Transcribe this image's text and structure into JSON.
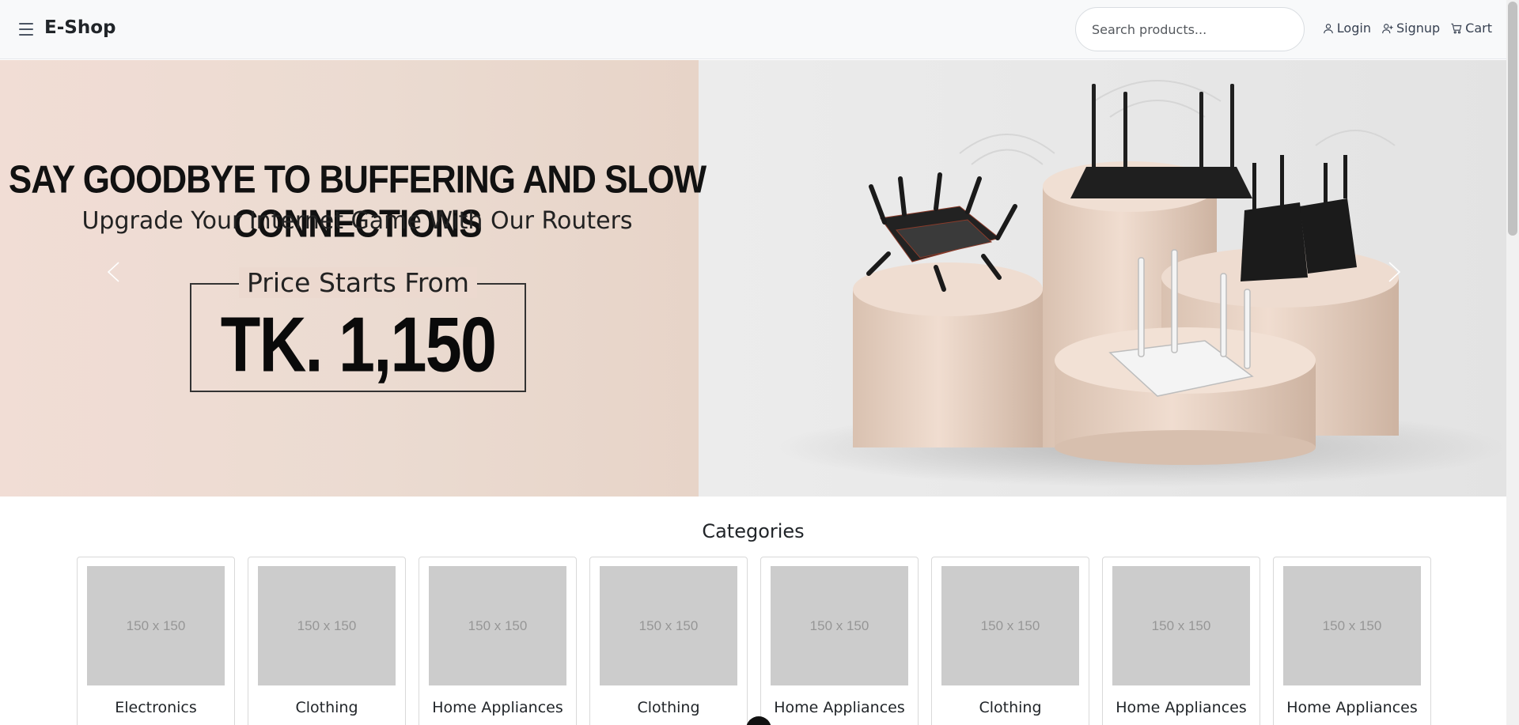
{
  "header": {
    "brand": "E-Shop",
    "search_placeholder": "Search products...",
    "links": {
      "login": "Login",
      "signup": "Signup",
      "cart": "Cart"
    }
  },
  "hero": {
    "headline": "SAY GOODBYE TO BUFFERING AND SLOW CONNECTIONS",
    "subline": "Upgrade Your Internet Game With Our Routers",
    "price_label": "Price Starts From",
    "price_value": "TK. 1,150"
  },
  "categories": {
    "title": "Categories",
    "placeholder_text": "150 x 150",
    "items": [
      {
        "name": "Electronics",
        "image_text": "150 x 150"
      },
      {
        "name": "Clothing",
        "image_text": "150 x 150"
      },
      {
        "name": "Home Appliances",
        "image_text": "150 x 150"
      },
      {
        "name": "Clothing",
        "image_text": "150 x 150"
      },
      {
        "name": "Home Appliances",
        "image_text": "150 x 150"
      },
      {
        "name": "Clothing",
        "image_text": "150 x 150"
      },
      {
        "name": "Home Appliances",
        "image_text": "150 x 150"
      },
      {
        "name": "Home Appliances",
        "image_text": "150 x 150"
      }
    ]
  },
  "icons": {
    "menu": "hamburger-menu-icon",
    "login": "user-icon",
    "signup": "user-plus-icon",
    "cart": "cart-icon",
    "prev": "chevron-left-icon",
    "next": "chevron-right-icon"
  }
}
